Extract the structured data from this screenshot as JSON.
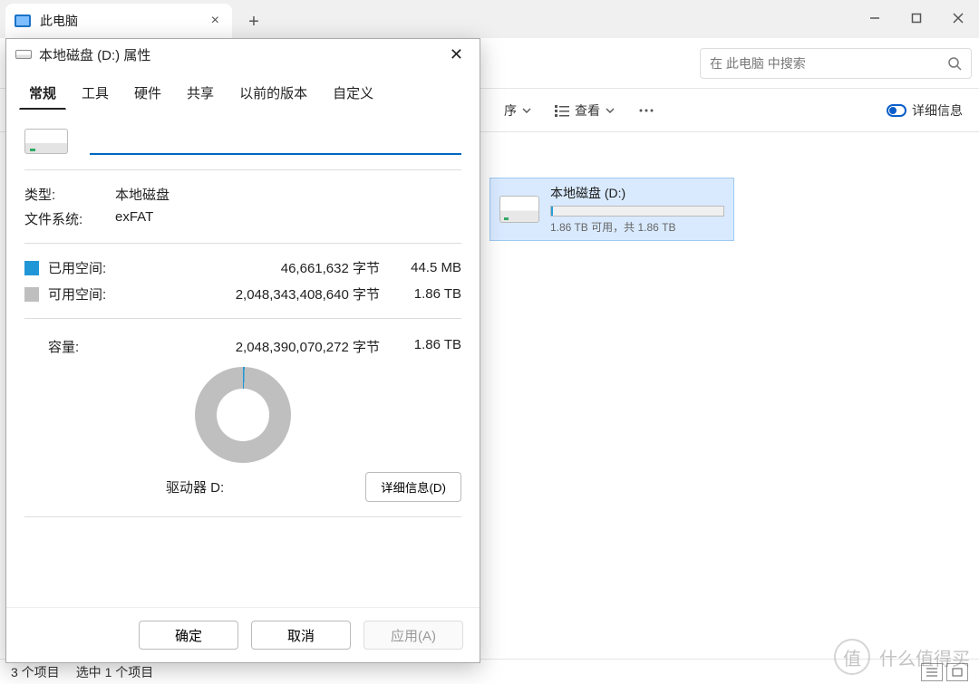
{
  "explorer": {
    "tab_title": "此电脑",
    "search_placeholder": "在 此电脑 中搜索",
    "toolbar": {
      "sort_fragment": "序",
      "view": "查看",
      "details": "详细信息"
    },
    "drive": {
      "name": "本地磁盘 (D:)",
      "cap_line": "1.86 TB 可用，共 1.86 TB"
    },
    "status": {
      "count": "3 个项目",
      "selected": "选中 1 个项目"
    }
  },
  "props": {
    "title": "本地磁盘 (D:) 属性",
    "tabs": [
      "常规",
      "工具",
      "硬件",
      "共享",
      "以前的版本",
      "自定义"
    ],
    "name_value": "",
    "type_label": "类型:",
    "type_value": "本地磁盘",
    "fs_label": "文件系统:",
    "fs_value": "exFAT",
    "used_label": "已用空间:",
    "used_bytes": "46,661,632 字节",
    "used_human": "44.5 MB",
    "free_label": "可用空间:",
    "free_bytes": "2,048,343,408,640 字节",
    "free_human": "1.86 TB",
    "cap_label": "容量:",
    "cap_bytes": "2,048,390,070,272 字节",
    "cap_human": "1.86 TB",
    "drive_line": "驱动器 D:",
    "details_btn": "详细信息(D)",
    "ok": "确定",
    "cancel": "取消",
    "apply": "应用(A)"
  },
  "watermark": {
    "stamp": "值",
    "text": "什么值得买"
  }
}
